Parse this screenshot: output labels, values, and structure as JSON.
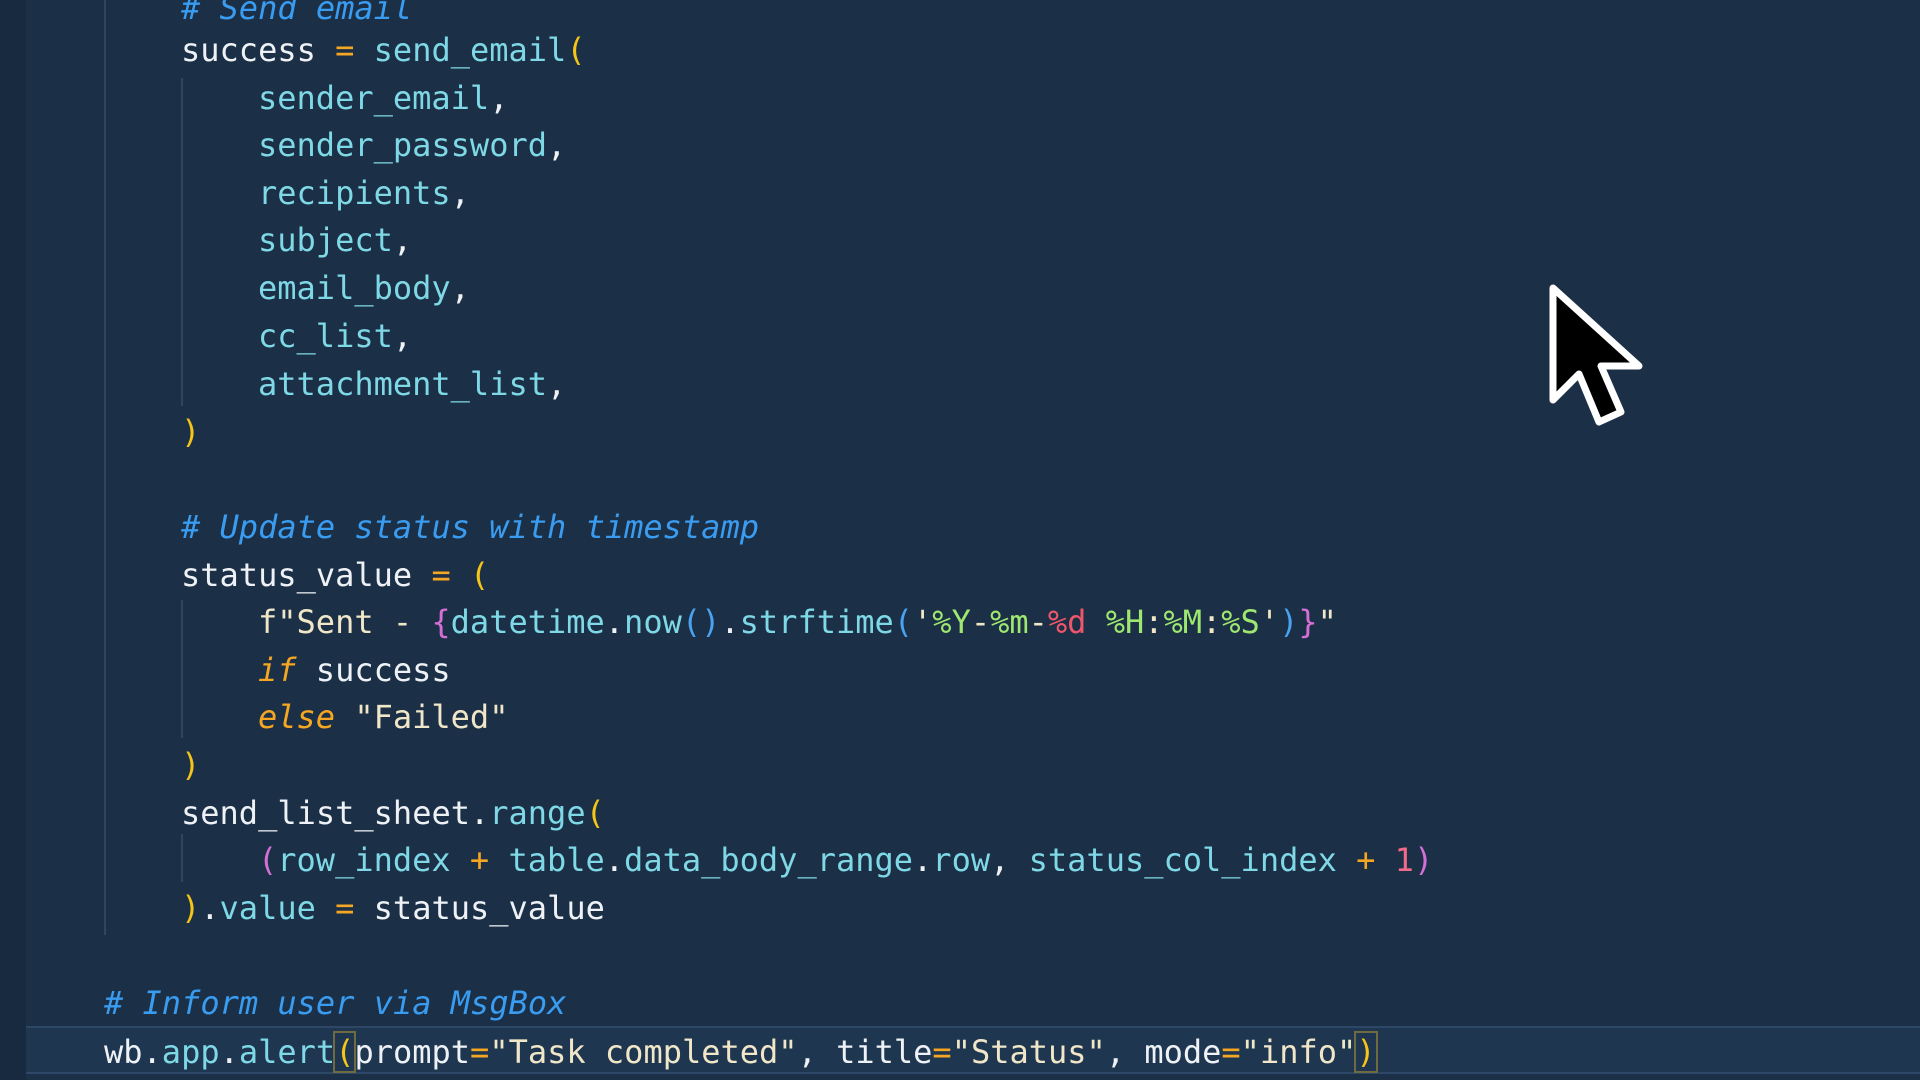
{
  "editor": {
    "lines": {
      "l0": {
        "comment": "# Send email"
      },
      "l1": {
        "var": "success",
        "eq": " = ",
        "fn": "send_email",
        "open": "("
      },
      "l2": {
        "arg": "sender_email",
        "comma": ","
      },
      "l3": {
        "arg": "sender_password",
        "comma": ","
      },
      "l4": {
        "arg": "recipients",
        "comma": ","
      },
      "l5": {
        "arg": "subject",
        "comma": ","
      },
      "l6": {
        "arg": "email_body",
        "comma": ","
      },
      "l7": {
        "arg": "cc_list",
        "comma": ","
      },
      "l8": {
        "arg": "attachment_list",
        "comma": ","
      },
      "l9": {
        "close": ")"
      },
      "l10": {
        "comment": "# Update status with timestamp"
      },
      "l11": {
        "var": "status_value",
        "eq": " = ",
        "open": "("
      },
      "l12": {
        "prefix": "f\"Sent - ",
        "brace_open": "{",
        "obj": "datetime",
        "dot1": ".",
        "m1": "now",
        "p1": "()",
        "dot2": ".",
        "m2": "strftime",
        "p2o": "(",
        "q1": "'",
        "f1": "%Y",
        "dash1": "-",
        "f2": "%m",
        "dash2": "-",
        "f3": "%d",
        "sp": " ",
        "f4": "%H",
        "c1": ":",
        "f5": "%M",
        "c2": ":",
        "f6": "%S",
        "q2": "'",
        "p2c": ")",
        "brace_close": "}",
        "suffix": "\""
      },
      "l13": {
        "kw": "if",
        "rest": " success"
      },
      "l14": {
        "kw": "else",
        "rest": " \"Failed\""
      },
      "l15": {
        "close": ")"
      },
      "l16": {
        "var": "send_list_sheet",
        "dot": ".",
        "fn": "range",
        "open": "("
      },
      "l17": {
        "open": "(",
        "a": "row_index",
        "plus1": " + ",
        "b": "table",
        "d1": ".",
        "c": "data_body_range",
        "d2": ".",
        "d": "row",
        "comma": ", ",
        "e": "status_col_index",
        "plus2": " + ",
        "num": "1",
        "close": ")"
      },
      "l18": {
        "close": ")",
        "dot": ".",
        "attr": "value",
        "eq": " = ",
        "val": "status_value"
      },
      "l19": {
        "comment": "# Inform user via MsgBox"
      },
      "l20": {
        "obj": "wb",
        "d1": ".",
        "app": "app",
        "d2": ".",
        "fn": "alert",
        "open": "(",
        "k1": "prompt",
        "eq1": "=",
        "v1": "\"Task completed\"",
        "c1": ", ",
        "k2": "title",
        "eq2": "=",
        "v2": "\"Status\"",
        "c2": ", ",
        "k3": "mode",
        "eq3": "=",
        "v3": "\"info\"",
        "close": ")"
      }
    }
  },
  "colors": {
    "background": "#1b2f46",
    "comment": "#3a9cf0",
    "keyword": "#f5a623",
    "identifier": "#7fd8e6",
    "string": "#f0e6c8",
    "number": "#f06a8a"
  },
  "cursor": {
    "icon": "mouse-pointer-icon"
  }
}
